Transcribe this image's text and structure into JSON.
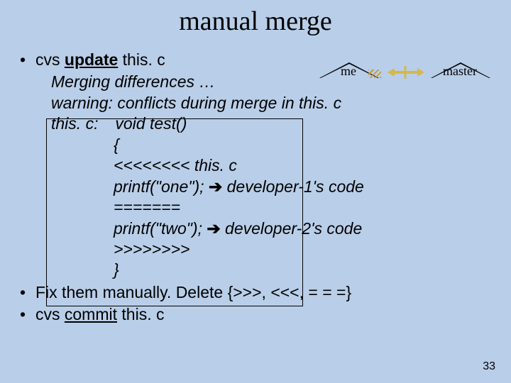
{
  "title": "manual merge",
  "bullets": {
    "b1_prefix": "cvs ",
    "b1_update": "update",
    "b1_suffix": " this. c",
    "b2_prefix": "Fix them manually.    Delete {>>>,   <<<,   = = =}",
    "b3_prefix": "cvs ",
    "b3_commit": "commit",
    "b3_suffix": " this. c"
  },
  "output": {
    "l1": "Merging differences …",
    "l2": "warning:  conflicts during merge in this. c",
    "l3a": "this. c:",
    "l3b": "void test()",
    "l4": "{",
    "l5": "<<<<<<<< this. c",
    "l6a": "printf(\"one\"); ",
    "l6arrow": "➔",
    "l6b": "   developer-1's  code",
    "l7": "=======",
    "l8a": "printf(\"two\"); ",
    "l8arrow": "➔",
    "l8b": "  developer-2's  code",
    "l9": ">>>>>>>>",
    "l10": "}"
  },
  "labels": {
    "me": "me",
    "master": "master"
  },
  "page_number": "33"
}
